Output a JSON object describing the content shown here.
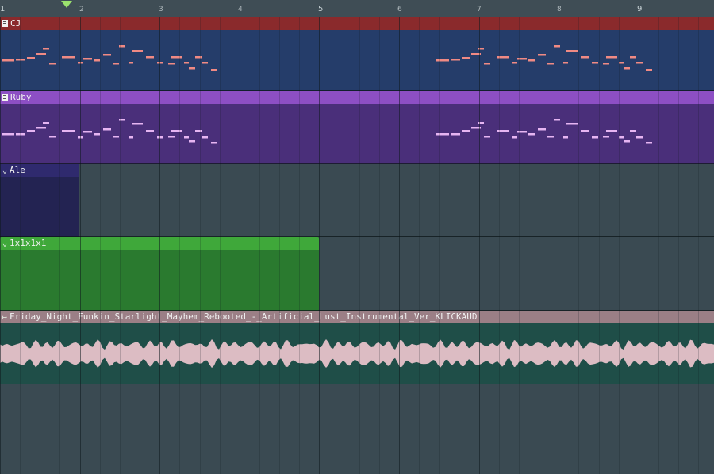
{
  "timeline": {
    "bars": [
      {
        "label": "1",
        "minor": false
      },
      {
        "label": "2",
        "minor": true
      },
      {
        "label": "3",
        "minor": true
      },
      {
        "label": "4",
        "minor": true
      },
      {
        "label": "5",
        "minor": false
      },
      {
        "label": "6",
        "minor": true
      },
      {
        "label": "7",
        "minor": true
      },
      {
        "label": "8",
        "minor": true
      },
      {
        "label": "9",
        "minor": false
      }
    ]
  },
  "clips": {
    "cj": {
      "name": "CJ",
      "icon": "pattern-icon",
      "color": "#8a2a2c",
      "body_color": "#253d6a",
      "note_color": "#f08a84"
    },
    "ruby": {
      "name": "Ruby",
      "icon": "pattern-icon",
      "color": "#8d4fc4",
      "body_color": "#4a2f7a",
      "note_color": "#e6b5f2"
    },
    "ale": {
      "name": "Ale",
      "icon": "chevron-down-icon",
      "color": "#2f2a6e",
      "body_color": "#232352"
    },
    "pattern4": {
      "name": "1x1x1x1",
      "icon": "chevron-down-icon",
      "color": "#3fa83a",
      "body_color": "#2a7a2f"
    },
    "audio": {
      "name": "Friday_Night_Funkin_Starlight_Mayhem_Rebooted_-_Artificial_Lust_Instrumental_Ver_KLICKAUD",
      "icon": "audio-clip-icon",
      "color": "#9b7f86",
      "body_color": "#1f4e48",
      "wave_color": "#dcbcc3"
    }
  }
}
